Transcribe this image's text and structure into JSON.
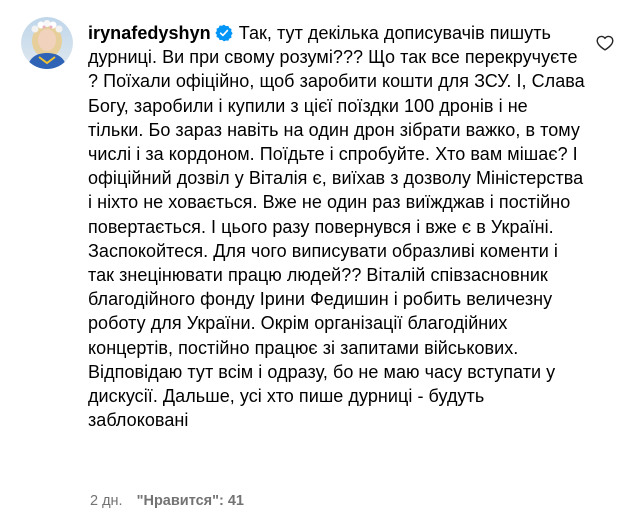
{
  "comment": {
    "avatar_icon": "user-avatar-photo",
    "username": "irynafedyshyn",
    "verified_icon": "verified-badge-icon",
    "text": "Так, тут декілька дописувачів пишуть дурниці. Ви при свому розумі??? Що так все перекручуєте ? Поїхали офіційно, щоб заробити кошти для ЗСУ. І, Слава Богу, заробили і купили з цієї поїздки 100 дронів і не тільки. Бо зараз навіть на один дрон зібрати важко, в тому числі і за кордоном. Поїдьте і спробуйте. Хто вам мішає? І офіційний дозвіл у Віталія є, виїхав з дозволу Міністерства і ніхто не ховається. Вже не один раз виїжджав і постійно повертається. І цього разу повернувся і вже є в Україні. Заспокойтеся. Для чого виписувати образливі коменти і так знецінювати працю людей?? Віталій співзасновник благодійного фонду Ірини Федишин і робить величезну роботу для України. Окрім організації благодійних концертів, постійно працює зі запитами військових. Відповідаю тут всім і одразу, бо не маю часу вступати у дискусії. Дальше, усі хто пише дурниці - будуть заблоковані",
    "time_ago": "2 дн.",
    "likes": "\"Нравится\": 41",
    "like_icon": "heart-icon"
  },
  "colors": {
    "text": "#000000",
    "meta": "#737373",
    "verified": "#0095f6",
    "background": "#ffffff"
  }
}
